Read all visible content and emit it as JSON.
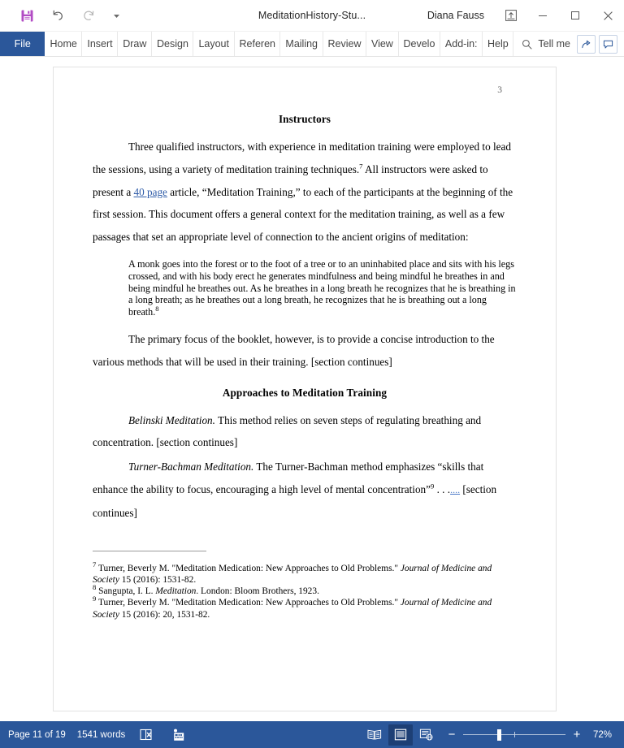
{
  "titlebar": {
    "quick_access": [
      {
        "name": "save",
        "icon": "save-icon",
        "color": "#b24cc4"
      },
      {
        "name": "undo",
        "icon": "undo-icon"
      },
      {
        "name": "redo",
        "icon": "redo-icon"
      },
      {
        "name": "customize",
        "icon": "chevron-down-icon"
      }
    ],
    "document_title": "MeditationHistory-Stu...",
    "user_name": "Diana Fauss",
    "window_buttons": {
      "ribbon_display": "ribbon-display-options-icon",
      "minimize": "minimize-icon",
      "maximize": "maximize-icon",
      "close": "close-icon"
    }
  },
  "ribbon": {
    "file_tab": "File",
    "tabs": [
      "Home",
      "Insert",
      "Draw",
      "Design",
      "Layout",
      "Referen",
      "Mailing",
      "Review",
      "View",
      "Develo",
      "Add-in:",
      "Help"
    ],
    "tell_me": "Tell me",
    "share_button": "share-icon",
    "comments_button": "comments-icon"
  },
  "document": {
    "page_number": "3",
    "heading_1": "Instructors",
    "paragraph_1": {
      "part1": "Three qualified instructors, with experience in meditation training were employed to lead the sessions, using a variety of meditation training techniques.",
      "footnote_ref1": "7",
      "part2": " All instructors were asked to present a ",
      "inserted": "40 page",
      "part3": " article, “Meditation Training,” to each of the participants at the beginning of the first session.  This document offers a general context for the meditation training, as well as a few passages that set an appropriate level of connection to the ancient origins of meditation:"
    },
    "blockquote": {
      "text": "A monk goes into the forest or to the foot of a tree or to an uninhabited place and sits with his legs crossed, and with his body erect he generates mindfulness and being mindful he breathes in and being mindful he breathes out. As he breathes in a long breath he recognizes that he is breathing in a long breath; as he breathes out a long breath, he recognizes that he is breathing out a long breath.",
      "footnote_ref": "8"
    },
    "paragraph_2": "The primary focus of the booklet, however, is to provide a concise introduction to the various methods that will be used in their training.  [section continues]",
    "heading_2": "Approaches to Meditation Training",
    "paragraph_3": {
      "run_in": "Belinski Meditation.",
      "text": " This method relies on seven steps of regulating breathing and concentration. [section continues]"
    },
    "paragraph_4": {
      "run_in": "Turner-Bachman Meditation.",
      "part1": " The Turner-Bachman method emphasizes “skills that enhance the ability to focus, encouraging a high level of mental concentration”",
      "footnote_ref": "9",
      "part2": " . . .",
      "inserted_mark1": "...",
      "inserted_mark2": ".",
      "part3": " [section continues]"
    },
    "footnotes": [
      {
        "marker": "7",
        "text_before": " Turner, Beverly M. \"Meditation Medication: New Approaches to Old Problems.\" ",
        "italic": "Journal of Medicine and Society",
        "text_after": " 15 (2016): 1531-82."
      },
      {
        "marker": "8",
        "text_before": " Sangupta, I. L. ",
        "italic": "Meditation",
        "text_after": ". London: Bloom Brothers, 1923."
      },
      {
        "marker": "9",
        "text_before": " Turner, Beverly M. \"Meditation Medication: New Approaches to Old Problems.\" ",
        "italic": "Journal of Medicine and Society",
        "text_after": " 15 (2016): 20, 1531-82."
      }
    ]
  },
  "statusbar": {
    "page_indicator": "Page 11 of 19",
    "word_count": "1541 words",
    "proofing_icon": "spelling-errors-icon",
    "accessibility_icon": "accessibility-checker-icon",
    "views": [
      {
        "name": "read-mode",
        "label": "Read Mode",
        "active": false
      },
      {
        "name": "print-layout",
        "label": "Print Layout",
        "active": true
      },
      {
        "name": "web-layout",
        "label": "Web Layout",
        "active": false
      }
    ],
    "zoom_out": "−",
    "zoom_in": "+",
    "zoom_level": "72%"
  },
  "colors": {
    "word_blue": "#2b579a",
    "status_active": "#1d3f75",
    "save_purple": "#b24cc4",
    "insertion_blue": "#2f5ca8"
  }
}
